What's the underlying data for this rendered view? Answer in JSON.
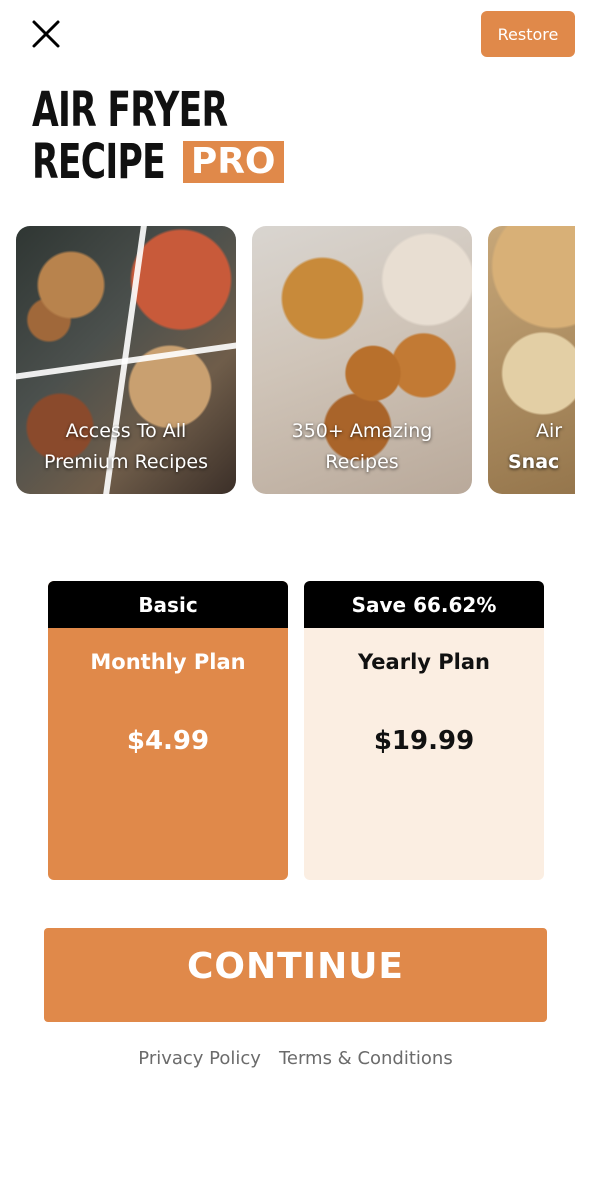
{
  "header": {
    "close_icon": "close-icon",
    "restore_label": "Restore"
  },
  "logo": {
    "line1": "AIR FRYER",
    "line2": "RECIPE",
    "badge": "PRO"
  },
  "carousel": {
    "cards": [
      {
        "line1": "Access To All",
        "line2": "Premium Recipes"
      },
      {
        "line1": "350+ Amazing",
        "line2": "Recipes"
      },
      {
        "line1": "Air",
        "line2": "Snac"
      }
    ]
  },
  "plans": [
    {
      "badge": "Basic",
      "name": "Monthly Plan",
      "price": "$4.99",
      "selected": true
    },
    {
      "badge": "Save 66.62%",
      "name": "Yearly Plan",
      "price": "$19.99",
      "selected": false
    }
  ],
  "cta": {
    "label": "CONTINUE"
  },
  "footer": {
    "privacy": "Privacy Policy",
    "terms": "Terms & Conditions"
  },
  "colors": {
    "accent": "#e0894a",
    "selected_light": "#fbeee2",
    "header_black": "#000000",
    "footer_text": "#6b6b6b"
  }
}
